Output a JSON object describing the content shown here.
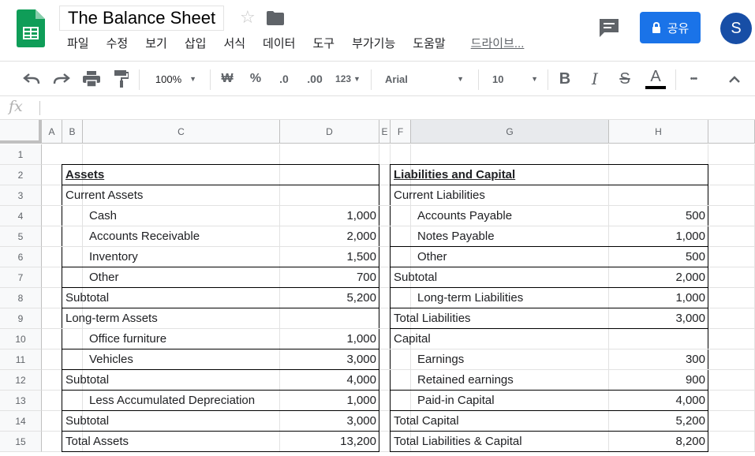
{
  "document": {
    "title": "The Balance Sheet"
  },
  "menu": [
    "파일",
    "수정",
    "보기",
    "삽입",
    "서식",
    "데이터",
    "도구",
    "부가기능",
    "도움말"
  ],
  "menu_drive": "드라이브...",
  "share": {
    "label": "공유"
  },
  "user": {
    "initial": "S"
  },
  "toolbar": {
    "zoom": "100%",
    "currency": "₩",
    "percent": "%",
    "dec_decrease": ".0",
    "dec_increase": ".00",
    "format_more": "123",
    "font": "Arial",
    "font_size": "10",
    "bold": "B",
    "italic": "I",
    "strike": "S",
    "text_color": "A",
    "more": "•••"
  },
  "formula": {
    "fx": "fx",
    "value": ""
  },
  "columns": [
    "A",
    "B",
    "C",
    "D",
    "E",
    "F",
    "G",
    "H"
  ],
  "rows": [
    "1",
    "2",
    "3",
    "4",
    "5",
    "6",
    "7",
    "8",
    "9",
    "10",
    "11",
    "12",
    "13",
    "14",
    "15"
  ],
  "assets": {
    "header": "Assets",
    "rows": [
      {
        "label": "Current Assets",
        "indent": false,
        "value": ""
      },
      {
        "label": "Cash",
        "indent": true,
        "value": "1,000"
      },
      {
        "label": "Accounts Receivable",
        "indent": true,
        "value": "2,000"
      },
      {
        "label": "Inventory",
        "indent": true,
        "value": "1,500"
      },
      {
        "label": "Other",
        "indent": true,
        "value": "700"
      },
      {
        "label": "Subtotal",
        "indent": false,
        "value": "5,200"
      },
      {
        "label": "Long-term Assets",
        "indent": false,
        "value": ""
      },
      {
        "label": "Office furniture",
        "indent": true,
        "value": "1,000"
      },
      {
        "label": "Vehicles",
        "indent": true,
        "value": "3,000"
      },
      {
        "label": "Subtotal",
        "indent": false,
        "value": "4,000"
      },
      {
        "label": "Less Accumulated Depreciation",
        "indent": true,
        "value": "1,000"
      },
      {
        "label": "Subtotal",
        "indent": false,
        "value": "3,000"
      },
      {
        "label": "Total Assets",
        "indent": false,
        "value": "13,200"
      }
    ]
  },
  "liabilities": {
    "header": "Liabilities and Capital",
    "rows": [
      {
        "label": "Current Liabilities",
        "indent": false,
        "value": ""
      },
      {
        "label": "Accounts Payable",
        "indent": true,
        "value": "500"
      },
      {
        "label": "Notes Payable",
        "indent": true,
        "value": "1,000"
      },
      {
        "label": "Other",
        "indent": true,
        "value": "500"
      },
      {
        "label": "Subtotal",
        "indent": false,
        "value": "2,000"
      },
      {
        "label": "Long-term Liabilities",
        "indent": true,
        "value": "1,000"
      },
      {
        "label": "Total Liabilities",
        "indent": false,
        "value": "3,000"
      },
      {
        "label": "Capital",
        "indent": false,
        "value": ""
      },
      {
        "label": "Earnings",
        "indent": true,
        "value": "300"
      },
      {
        "label": "Retained earnings",
        "indent": true,
        "value": "900"
      },
      {
        "label": "Paid-in Capital",
        "indent": true,
        "value": "4,000"
      },
      {
        "label": "Total Capital",
        "indent": false,
        "value": "5,200"
      },
      {
        "label": "Total Liabilities & Capital",
        "indent": false,
        "value": "8,200"
      }
    ]
  },
  "colors": {
    "share_button": "#1a73e8",
    "avatar": "#174ea6",
    "sheets_green": "#0f9d58"
  }
}
